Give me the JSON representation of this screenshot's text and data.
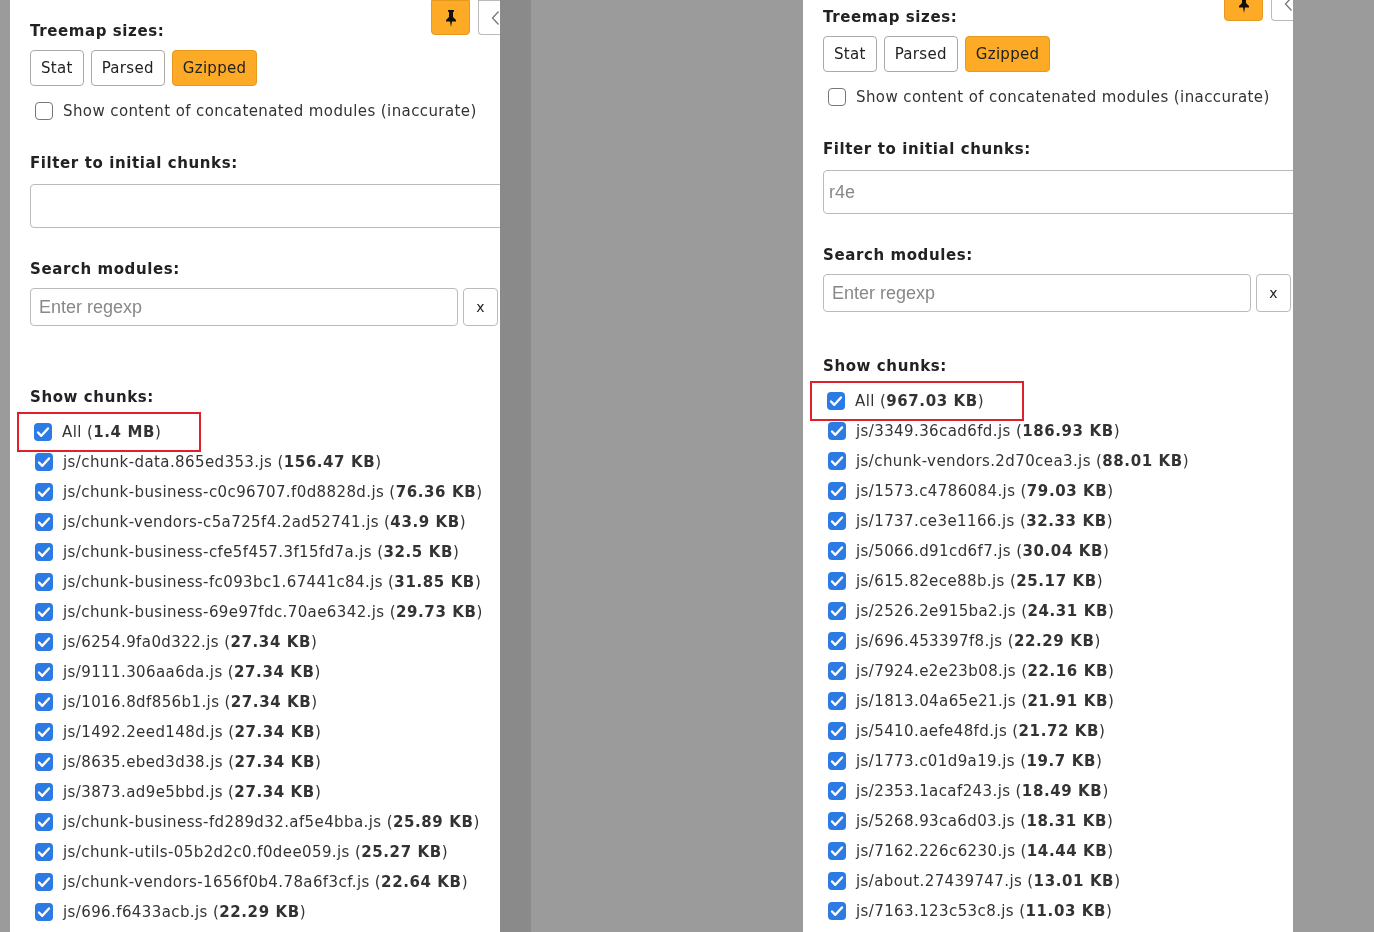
{
  "panels": [
    {
      "pin_button": {
        "pinned": true
      },
      "title": "Treemap sizes:",
      "size_buttons": [
        {
          "label": "Stat",
          "selected": false
        },
        {
          "label": "Parsed",
          "selected": false
        },
        {
          "label": "Gzipped",
          "selected": true
        }
      ],
      "concat_option": {
        "label": "Show content of concatenated modules (inaccurate)",
        "checked": false
      },
      "filter": {
        "label": "Filter to initial chunks:"
      },
      "search": {
        "label": "Search modules:",
        "placeholder": "Enter regexp",
        "clear": "x"
      },
      "chunks": {
        "label": "Show chunks:",
        "items": [
          {
            "label": "All (**1.4 MB**)",
            "checked": true,
            "highlighted": true
          },
          {
            "label": "js/chunk-data.865ed353.js (**156.47 KB**)",
            "checked": true,
            "highlighted": false
          },
          {
            "label": "js/chunk-business-c0c96707.f0d8828d.js (**76.36 KB**)",
            "checked": true,
            "highlighted": false
          },
          {
            "label": "js/chunk-vendors-c5a725f4.2ad52741.js (**43.9 KB**)",
            "checked": true,
            "highlighted": false
          },
          {
            "label": "js/chunk-business-cfe5f457.3f15fd7a.js (**32.5 KB**)",
            "checked": true,
            "highlighted": false
          },
          {
            "label": "js/chunk-business-fc093bc1.67441c84.js (**31.85 KB**)",
            "checked": true,
            "highlighted": false
          },
          {
            "label": "js/chunk-business-69e97fdc.70ae6342.js (**29.73 KB**)",
            "checked": true,
            "highlighted": false
          },
          {
            "label": "js/6254.9fa0d322.js (**27.34 KB**)",
            "checked": true,
            "highlighted": false
          },
          {
            "label": "js/9111.306aa6da.js (**27.34 KB**)",
            "checked": true,
            "highlighted": false
          },
          {
            "label": "js/1016.8df856b1.js (**27.34 KB**)",
            "checked": true,
            "highlighted": false
          },
          {
            "label": "js/1492.2eed148d.js (**27.34 KB**)",
            "checked": true,
            "highlighted": false
          },
          {
            "label": "js/8635.ebed3d38.js (**27.34 KB**)",
            "checked": true,
            "highlighted": false
          },
          {
            "label": "js/3873.ad9e5bbd.js (**27.34 KB**)",
            "checked": true,
            "highlighted": false
          },
          {
            "label": "js/chunk-business-fd289d32.af5e4bba.js (**25.89 KB**)",
            "checked": true,
            "highlighted": false
          },
          {
            "label": "js/chunk-utils-05b2d2c0.f0dee059.js (**25.27 KB**)",
            "checked": true,
            "highlighted": false
          },
          {
            "label": "js/chunk-vendors-1656f0b4.78a6f3cf.js (**22.64 KB**)",
            "checked": true,
            "highlighted": false
          },
          {
            "label": "js/696.f6433acb.js (**22.29 KB**)",
            "checked": true,
            "highlighted": false
          }
        ]
      }
    },
    {
      "pin_button": {
        "pinned": true
      },
      "title": "Treemap sizes:",
      "size_buttons": [
        {
          "label": "Stat",
          "selected": false
        },
        {
          "label": "Parsed",
          "selected": false
        },
        {
          "label": "Gzipped",
          "selected": true
        }
      ],
      "concat_option": {
        "label": "Show content of concatenated modules (inaccurate)",
        "checked": false
      },
      "filter": {
        "label": "Filter to initial chunks:",
        "value": "r4e"
      },
      "search": {
        "label": "Search modules:",
        "placeholder": "Enter regexp",
        "clear": "x"
      },
      "chunks": {
        "label": "Show chunks:",
        "items": [
          {
            "label": "All (**967.03 KB**)",
            "checked": true,
            "highlighted": true
          },
          {
            "label": "js/3349.36cad6fd.js (**186.93 KB**)",
            "checked": true,
            "highlighted": false
          },
          {
            "label": "js/chunk-vendors.2d70cea3.js (**88.01 KB**)",
            "checked": true,
            "highlighted": false
          },
          {
            "label": "js/1573.c4786084.js (**79.03 KB**)",
            "checked": true,
            "highlighted": false
          },
          {
            "label": "js/1737.ce3e1166.js (**32.33 KB**)",
            "checked": true,
            "highlighted": false
          },
          {
            "label": "js/5066.d91cd6f7.js (**30.04 KB**)",
            "checked": true,
            "highlighted": false
          },
          {
            "label": "js/615.82ece88b.js (**25.17 KB**)",
            "checked": true,
            "highlighted": false
          },
          {
            "label": "js/2526.2e915ba2.js (**24.31 KB**)",
            "checked": true,
            "highlighted": false
          },
          {
            "label": "js/696.453397f8.js (**22.29 KB**)",
            "checked": true,
            "highlighted": false
          },
          {
            "label": "js/7924.e2e23b08.js (**22.16 KB**)",
            "checked": true,
            "highlighted": false
          },
          {
            "label": "js/1813.04a65e21.js (**21.91 KB**)",
            "checked": true,
            "highlighted": false
          },
          {
            "label": "js/5410.aefe48fd.js (**21.72 KB**)",
            "checked": true,
            "highlighted": false
          },
          {
            "label": "js/1773.c01d9a19.js (**19.7 KB**)",
            "checked": true,
            "highlighted": false
          },
          {
            "label": "js/2353.1acaf243.js (**18.49 KB**)",
            "checked": true,
            "highlighted": false
          },
          {
            "label": "js/5268.93ca6d03.js (**18.31 KB**)",
            "checked": true,
            "highlighted": false
          },
          {
            "label": "js/7162.226c6230.js (**14.44 KB**)",
            "checked": true,
            "highlighted": false
          },
          {
            "label": "js/about.27439747.js (**13.01 KB**)",
            "checked": true,
            "highlighted": false
          },
          {
            "label": "js/7163.123c53c8.js (**11.03 KB**)",
            "checked": true,
            "highlighted": false
          }
        ]
      }
    }
  ]
}
